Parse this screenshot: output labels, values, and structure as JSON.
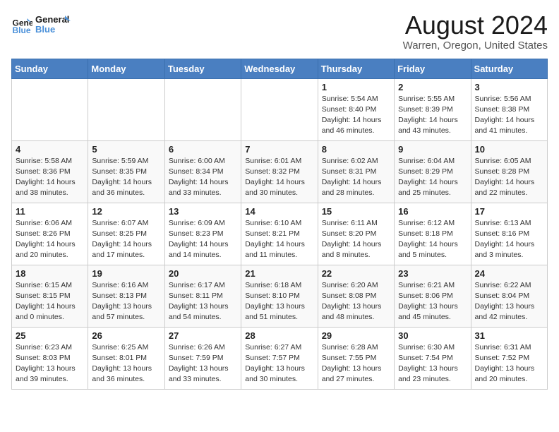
{
  "logo": {
    "line1": "General",
    "line2": "Blue"
  },
  "title": "August 2024",
  "location": "Warren, Oregon, United States",
  "days_header": [
    "Sunday",
    "Monday",
    "Tuesday",
    "Wednesday",
    "Thursday",
    "Friday",
    "Saturday"
  ],
  "weeks": [
    [
      {
        "num": "",
        "info": ""
      },
      {
        "num": "",
        "info": ""
      },
      {
        "num": "",
        "info": ""
      },
      {
        "num": "",
        "info": ""
      },
      {
        "num": "1",
        "info": "Sunrise: 5:54 AM\nSunset: 8:40 PM\nDaylight: 14 hours\nand 46 minutes."
      },
      {
        "num": "2",
        "info": "Sunrise: 5:55 AM\nSunset: 8:39 PM\nDaylight: 14 hours\nand 43 minutes."
      },
      {
        "num": "3",
        "info": "Sunrise: 5:56 AM\nSunset: 8:38 PM\nDaylight: 14 hours\nand 41 minutes."
      }
    ],
    [
      {
        "num": "4",
        "info": "Sunrise: 5:58 AM\nSunset: 8:36 PM\nDaylight: 14 hours\nand 38 minutes."
      },
      {
        "num": "5",
        "info": "Sunrise: 5:59 AM\nSunset: 8:35 PM\nDaylight: 14 hours\nand 36 minutes."
      },
      {
        "num": "6",
        "info": "Sunrise: 6:00 AM\nSunset: 8:34 PM\nDaylight: 14 hours\nand 33 minutes."
      },
      {
        "num": "7",
        "info": "Sunrise: 6:01 AM\nSunset: 8:32 PM\nDaylight: 14 hours\nand 30 minutes."
      },
      {
        "num": "8",
        "info": "Sunrise: 6:02 AM\nSunset: 8:31 PM\nDaylight: 14 hours\nand 28 minutes."
      },
      {
        "num": "9",
        "info": "Sunrise: 6:04 AM\nSunset: 8:29 PM\nDaylight: 14 hours\nand 25 minutes."
      },
      {
        "num": "10",
        "info": "Sunrise: 6:05 AM\nSunset: 8:28 PM\nDaylight: 14 hours\nand 22 minutes."
      }
    ],
    [
      {
        "num": "11",
        "info": "Sunrise: 6:06 AM\nSunset: 8:26 PM\nDaylight: 14 hours\nand 20 minutes."
      },
      {
        "num": "12",
        "info": "Sunrise: 6:07 AM\nSunset: 8:25 PM\nDaylight: 14 hours\nand 17 minutes."
      },
      {
        "num": "13",
        "info": "Sunrise: 6:09 AM\nSunset: 8:23 PM\nDaylight: 14 hours\nand 14 minutes."
      },
      {
        "num": "14",
        "info": "Sunrise: 6:10 AM\nSunset: 8:21 PM\nDaylight: 14 hours\nand 11 minutes."
      },
      {
        "num": "15",
        "info": "Sunrise: 6:11 AM\nSunset: 8:20 PM\nDaylight: 14 hours\nand 8 minutes."
      },
      {
        "num": "16",
        "info": "Sunrise: 6:12 AM\nSunset: 8:18 PM\nDaylight: 14 hours\nand 5 minutes."
      },
      {
        "num": "17",
        "info": "Sunrise: 6:13 AM\nSunset: 8:16 PM\nDaylight: 14 hours\nand 3 minutes."
      }
    ],
    [
      {
        "num": "18",
        "info": "Sunrise: 6:15 AM\nSunset: 8:15 PM\nDaylight: 14 hours\nand 0 minutes."
      },
      {
        "num": "19",
        "info": "Sunrise: 6:16 AM\nSunset: 8:13 PM\nDaylight: 13 hours\nand 57 minutes."
      },
      {
        "num": "20",
        "info": "Sunrise: 6:17 AM\nSunset: 8:11 PM\nDaylight: 13 hours\nand 54 minutes."
      },
      {
        "num": "21",
        "info": "Sunrise: 6:18 AM\nSunset: 8:10 PM\nDaylight: 13 hours\nand 51 minutes."
      },
      {
        "num": "22",
        "info": "Sunrise: 6:20 AM\nSunset: 8:08 PM\nDaylight: 13 hours\nand 48 minutes."
      },
      {
        "num": "23",
        "info": "Sunrise: 6:21 AM\nSunset: 8:06 PM\nDaylight: 13 hours\nand 45 minutes."
      },
      {
        "num": "24",
        "info": "Sunrise: 6:22 AM\nSunset: 8:04 PM\nDaylight: 13 hours\nand 42 minutes."
      }
    ],
    [
      {
        "num": "25",
        "info": "Sunrise: 6:23 AM\nSunset: 8:03 PM\nDaylight: 13 hours\nand 39 minutes."
      },
      {
        "num": "26",
        "info": "Sunrise: 6:25 AM\nSunset: 8:01 PM\nDaylight: 13 hours\nand 36 minutes."
      },
      {
        "num": "27",
        "info": "Sunrise: 6:26 AM\nSunset: 7:59 PM\nDaylight: 13 hours\nand 33 minutes."
      },
      {
        "num": "28",
        "info": "Sunrise: 6:27 AM\nSunset: 7:57 PM\nDaylight: 13 hours\nand 30 minutes."
      },
      {
        "num": "29",
        "info": "Sunrise: 6:28 AM\nSunset: 7:55 PM\nDaylight: 13 hours\nand 27 minutes."
      },
      {
        "num": "30",
        "info": "Sunrise: 6:30 AM\nSunset: 7:54 PM\nDaylight: 13 hours\nand 23 minutes."
      },
      {
        "num": "31",
        "info": "Sunrise: 6:31 AM\nSunset: 7:52 PM\nDaylight: 13 hours\nand 20 minutes."
      }
    ]
  ]
}
